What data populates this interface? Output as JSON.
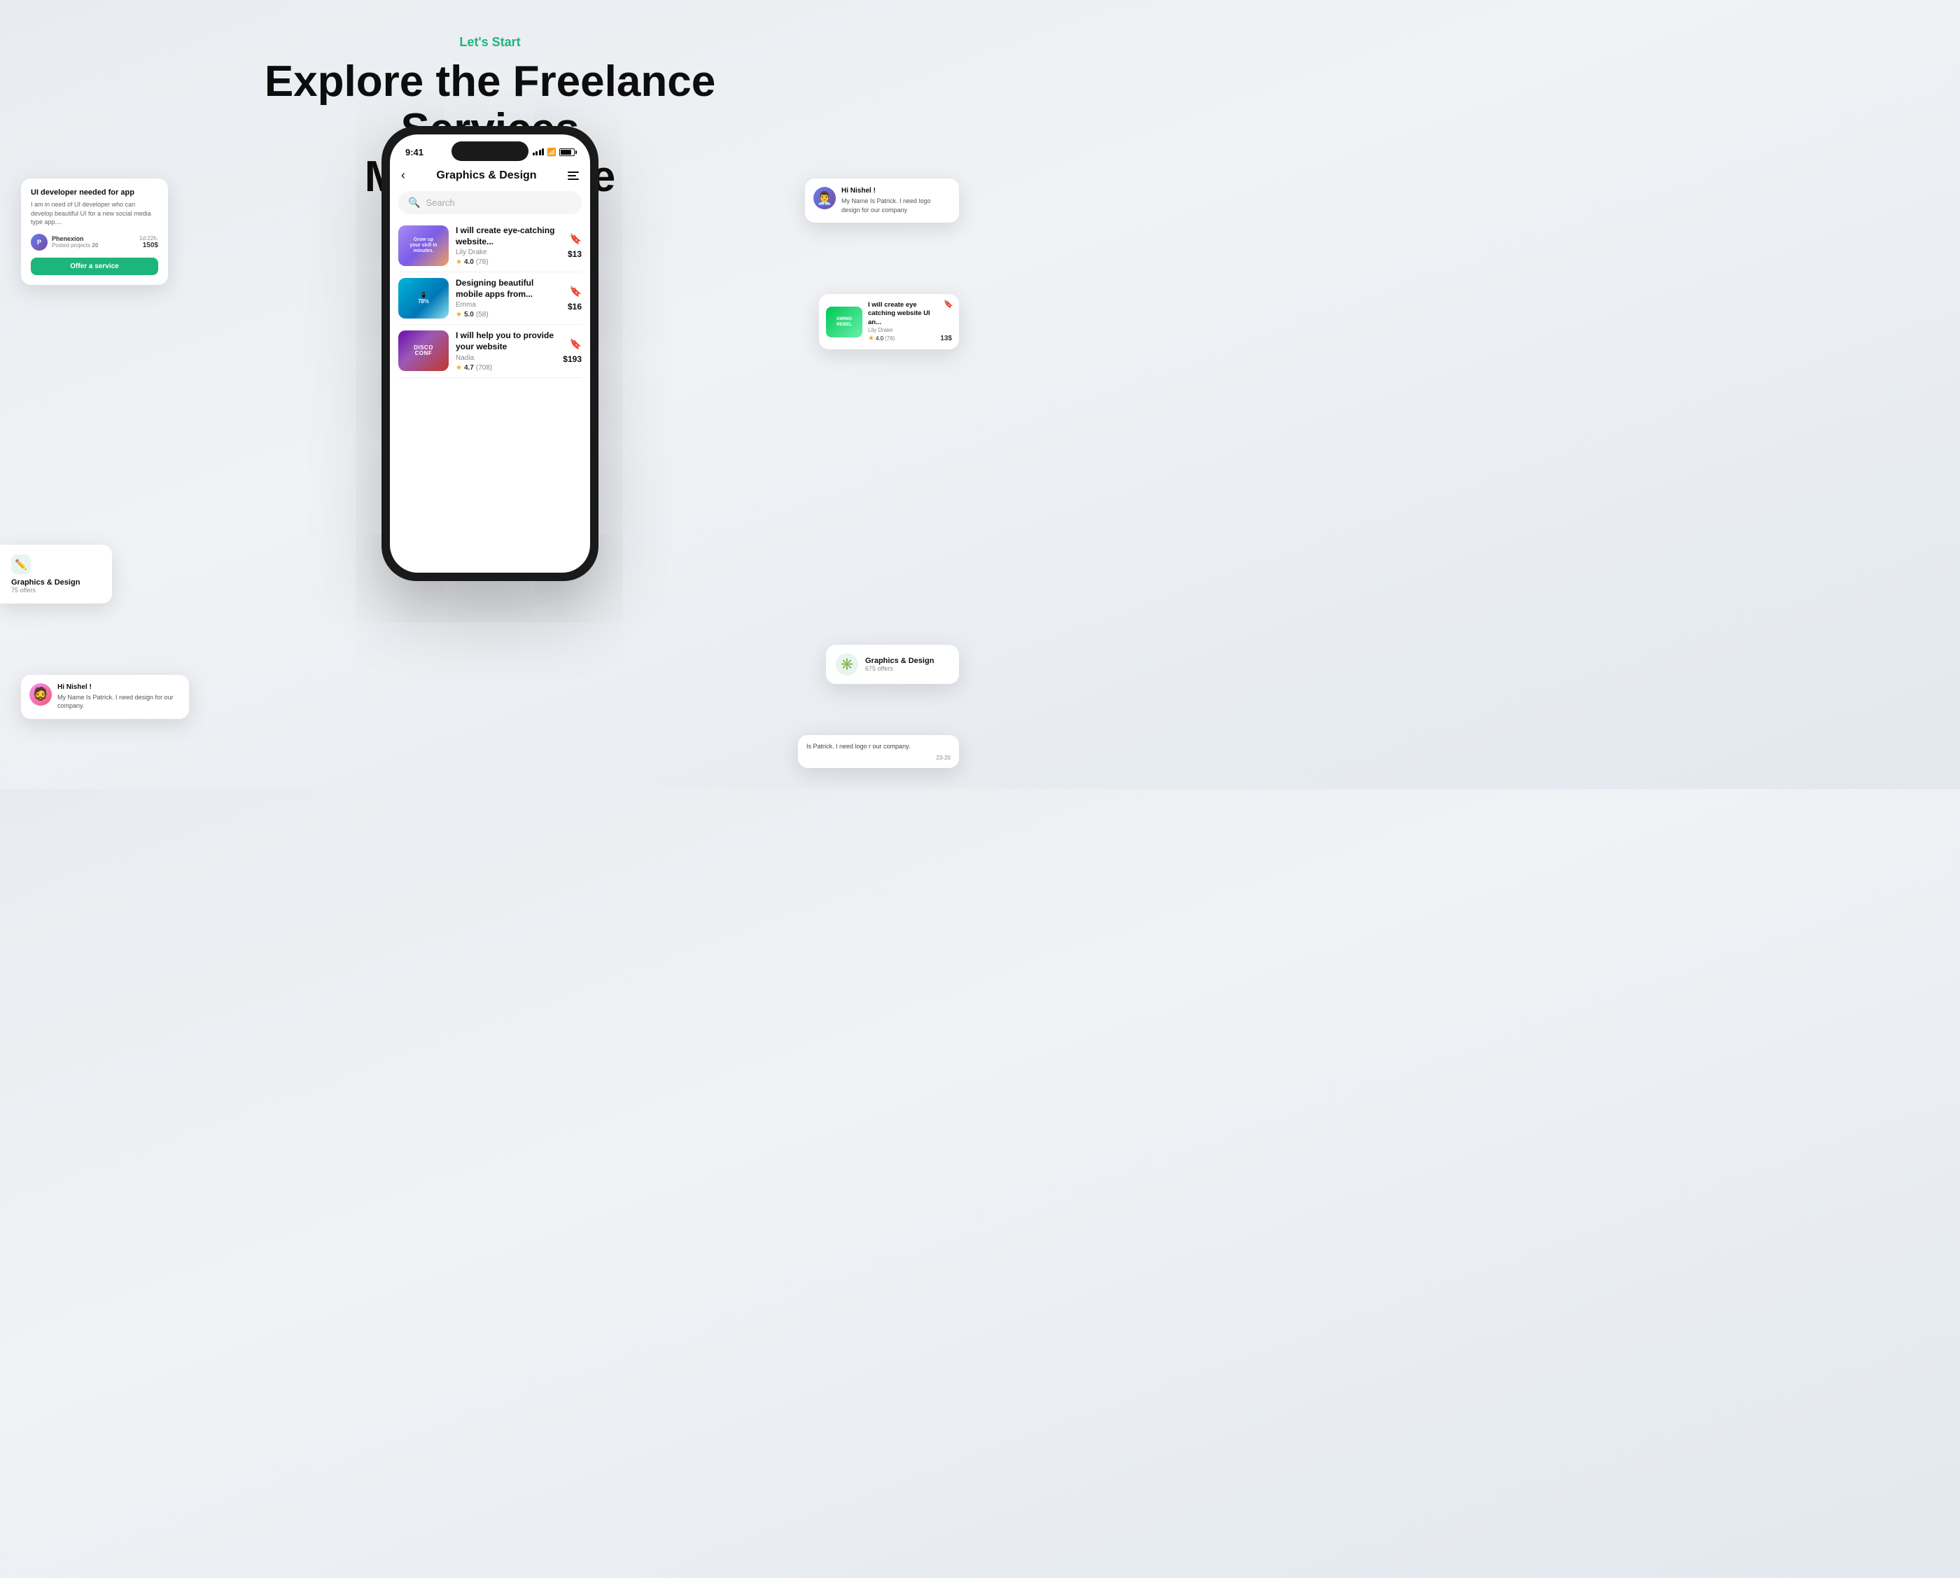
{
  "header": {
    "lets_start": "Let's Start",
    "main_title_line1": "Explore the Freelance Services",
    "main_title_line2": "Marketplace"
  },
  "phone": {
    "status_time": "9:41",
    "app_title": "Graphics & Design",
    "search_placeholder": "Search"
  },
  "services": [
    {
      "title": "I will create eye-catching website...",
      "author": "Lily Drake",
      "rating": "4.0",
      "reviews": "(78)",
      "price": "$13",
      "bookmarked": true,
      "thumb_type": "1"
    },
    {
      "title": "Designing beautiful mobile apps from...",
      "author": "Emma",
      "rating": "5.0",
      "reviews": "(58)",
      "price": "$16",
      "bookmarked": false,
      "thumb_type": "2"
    },
    {
      "title": "I will help you to provide your website",
      "author": "Nadia",
      "rating": "4.7",
      "reviews": "(708)",
      "price": "$193",
      "bookmarked": false,
      "thumb_type": "3"
    }
  ],
  "cards": {
    "job_card": {
      "title": "UI developer needed for app",
      "description": "I am in need of UI developer who can develop beautiful UI for a new social media type app....",
      "user_name": "Phenexion",
      "user_label": "Posted projects",
      "user_projects": "20",
      "time": "1d.22h.",
      "price": "150$",
      "offer_button": "Offer a service"
    },
    "category_left": {
      "name": "Graphics & Design",
      "offers": "75 offers"
    },
    "chat_left": {
      "greeting": "Hi Nishel !",
      "message": "My Name Is Patrick. I need design for our company."
    },
    "chat_right_top": {
      "greeting": "Hi Nishel !",
      "message": "My Name Is Patrick. I need logo design for our company"
    },
    "service_right": {
      "title": "I will create eye catching website UI an...",
      "author": "Lily Drake",
      "rating": "4.0",
      "reviews": "(78)",
      "price": "13$"
    },
    "category_right": {
      "name": "Graphics & Design",
      "offers": "675 offers"
    },
    "chat_bottom_right": {
      "text": "Is Patrick. I need logo r our company.",
      "time": "23-20"
    }
  }
}
